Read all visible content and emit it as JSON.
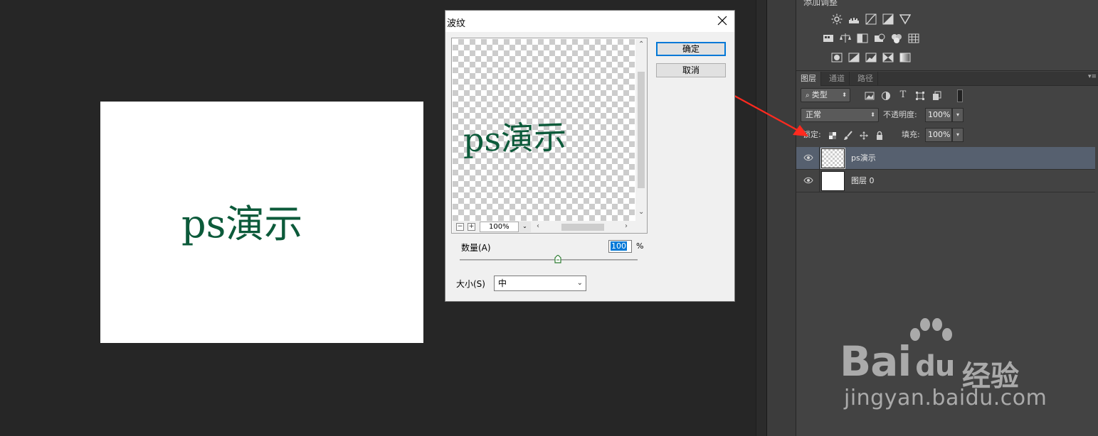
{
  "document": {
    "canvas_text": "ps演示",
    "text_color": "#0c5a3a"
  },
  "dialog": {
    "title": "波纹",
    "ok_label": "确定",
    "cancel_label": "取消",
    "preview_text": "ps演示",
    "zoom_value": "100%",
    "zoom_minus": "−",
    "zoom_plus": "+",
    "amount_label": "数量(A)",
    "amount_value": "100",
    "amount_unit": "%",
    "amount_slider_fraction": 0.55,
    "size_label": "大小(S)",
    "size_value": "中"
  },
  "adjustments": {
    "title": "添加调整"
  },
  "layers_panel": {
    "tabs": [
      {
        "label": "图层",
        "active": true
      },
      {
        "label": "通道",
        "active": false
      },
      {
        "label": "路径",
        "active": false
      }
    ],
    "filter_kind": "类型",
    "blend_mode": "正常",
    "opacity_label": "不透明度:",
    "opacity_value": "100%",
    "lock_label": "锁定:",
    "fill_label": "填充:",
    "fill_value": "100%",
    "layers": [
      {
        "name": "ps演示",
        "selected": true,
        "thumb": "transparent"
      },
      {
        "name": "图层 0",
        "selected": false,
        "thumb": "white"
      }
    ]
  },
  "watermark": {
    "brand": "Bai",
    "brand2": "du",
    "product": "经验",
    "url": "jingyan.baidu.com"
  },
  "colors": {
    "accent_blue": "#0078d7",
    "selected_layer": "#56606f",
    "annotation_arrow": "#ff2a1f"
  }
}
